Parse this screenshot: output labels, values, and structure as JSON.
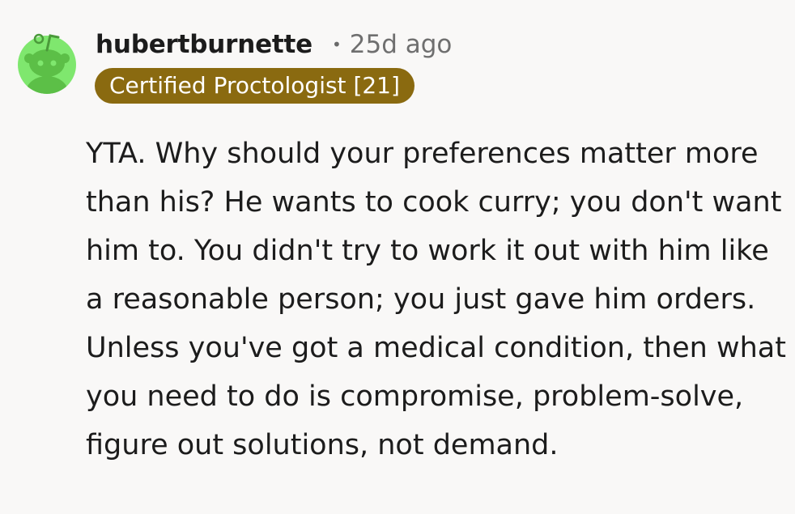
{
  "comment": {
    "author": "hubertburnette",
    "separator": "•",
    "timestamp": "25d ago",
    "flair": "Certified Proctologist [21]",
    "body": "YTA. Why should your preferences matter more than his? He wants to cook curry; you don't want him to. You didn't try to work it out with him like a reasonable person; you just gave him orders. Unless you've got a medical condition, then what you need to do is compromise, problem-solve, figure out solutions, not demand.",
    "avatar_icon": "snoo-avatar-icon"
  },
  "colors": {
    "background": "#f9f8f7",
    "avatar_bg": "#7fe76e",
    "avatar_snoo": "#5cbf47",
    "flair_bg": "#8a6a10",
    "flair_text": "#ffffff",
    "meta_text": "#6f6f6f"
  }
}
